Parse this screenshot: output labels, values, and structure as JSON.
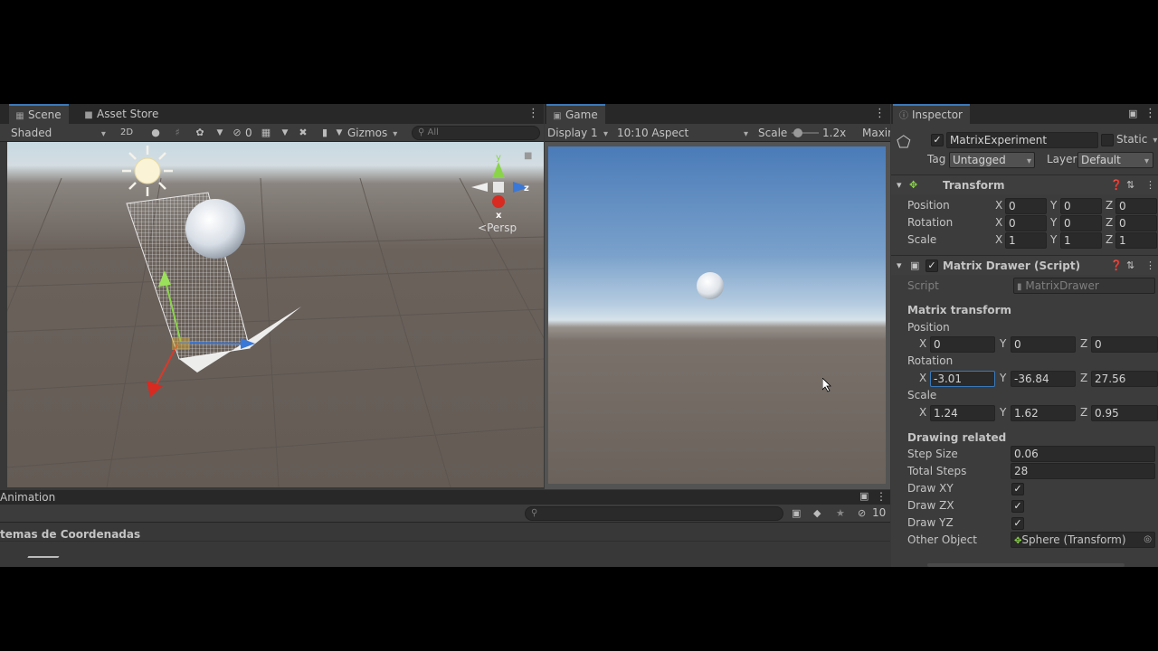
{
  "scene_panel": {
    "tabs": [
      {
        "label": "Scene",
        "icon": "scene-grid-icon"
      },
      {
        "label": "Asset Store",
        "icon": "bag-icon"
      }
    ],
    "shading_mode": "Shaded",
    "mode_2d": "2D",
    "hidden_count": "0",
    "gizmos_label": "Gizmos",
    "search_placeholder": "All",
    "persp_label": "Persp",
    "axis_labels": {
      "y": "y",
      "z": "z",
      "x": "x"
    }
  },
  "game_panel": {
    "tab": "Game",
    "display": "Display 1",
    "aspect": "10:10 Aspect",
    "scale_label": "Scale",
    "scale_value": "1.2x",
    "maximize_label": "Maxir",
    "scale_level": 0.1
  },
  "inspector": {
    "tab": "Inspector",
    "object_name": "MatrixExperiment",
    "static_label": "Static",
    "tag_label": "Tag",
    "tag_value": "Untagged",
    "layer_label": "Layer",
    "layer_value": "Default",
    "transform": {
      "title": "Transform",
      "rows": [
        {
          "label": "Position",
          "x": "0",
          "y": "0",
          "z": "0"
        },
        {
          "label": "Rotation",
          "x": "0",
          "y": "0",
          "z": "0"
        },
        {
          "label": "Scale",
          "x": "1",
          "y": "1",
          "z": "1"
        }
      ]
    },
    "matrix_drawer": {
      "title": "Matrix Drawer (Script)",
      "script_label": "Script",
      "script_value": "MatrixDrawer",
      "section_transform": "Matrix transform",
      "position_label": "Position",
      "position": {
        "x": "0",
        "y": "0",
        "z": "0"
      },
      "rotation_label": "Rotation",
      "rotation": {
        "x": "-3.01",
        "y": "-36.84",
        "z": "27.56"
      },
      "scale_label": "Scale",
      "scale": {
        "x": "1.24",
        "y": "1.62",
        "z": "0.95"
      },
      "section_drawing": "Drawing related",
      "step_size_label": "Step Size",
      "step_size": "0.06",
      "total_steps_label": "Total Steps",
      "total_steps": "28",
      "draw_xy_label": "Draw XY",
      "draw_zx_label": "Draw ZX",
      "draw_yz_label": "Draw YZ",
      "other_object_label": "Other Object",
      "other_object_value": "Sphere (Transform)"
    },
    "axes": {
      "x": "X",
      "y": "Y",
      "z": "Z"
    }
  },
  "animation_panel": {
    "tab": "Animation",
    "hidden_count": "10",
    "breadcrumb": "temas de Coordenadas"
  },
  "colors": {
    "accent": "#3a79bb",
    "panel": "#383838",
    "header": "#282828"
  }
}
